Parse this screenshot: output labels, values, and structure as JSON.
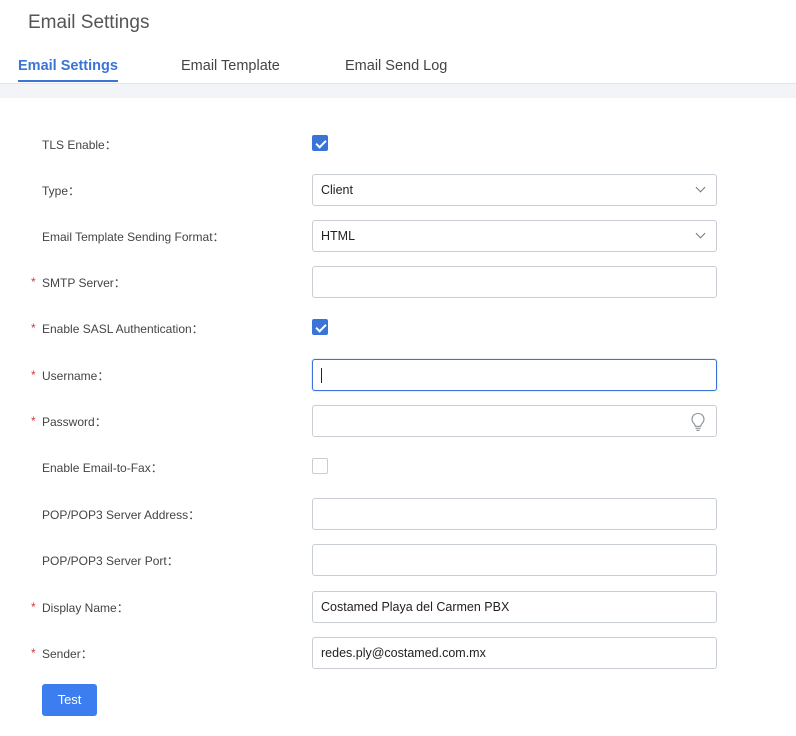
{
  "page": {
    "title": "Email Settings"
  },
  "tabs": [
    {
      "label": "Email Settings",
      "active": true
    },
    {
      "label": "Email Template",
      "active": false
    },
    {
      "label": "Email Send Log",
      "active": false
    }
  ],
  "form": {
    "tls_enable": {
      "label": "TLS Enable：",
      "checked": true,
      "required": false
    },
    "type": {
      "label": "Type：",
      "value": "Client",
      "required": false
    },
    "sending_format": {
      "label": "Email Template Sending Format：",
      "value": "HTML",
      "required": false
    },
    "smtp_server": {
      "label": "SMTP Server：",
      "value": "",
      "required": true,
      "required_mark": "*"
    },
    "sasl_auth": {
      "label": "Enable SASL Authentication：",
      "checked": true,
      "required": true,
      "required_mark": "*"
    },
    "username": {
      "label": "Username：",
      "value": "",
      "required": true,
      "required_mark": "*",
      "focused": true
    },
    "password": {
      "label": "Password：",
      "value": "",
      "required": true,
      "required_mark": "*",
      "icon": "lightbulb-icon"
    },
    "email_to_fax": {
      "label": "Enable Email-to-Fax：",
      "checked": false,
      "required": false
    },
    "pop_server_address": {
      "label": "POP/POP3 Server Address：",
      "value": "",
      "required": false
    },
    "pop_server_port": {
      "label": "POP/POP3 Server Port：",
      "value": "",
      "required": false
    },
    "display_name": {
      "label": "Display Name：",
      "value": "Costamed Playa del Carmen PBX",
      "required": true,
      "required_mark": "*"
    },
    "sender": {
      "label": "Sender：",
      "value": "redes.ply@costamed.com.mx",
      "required": true,
      "required_mark": "*"
    }
  },
  "actions": {
    "test_label": "Test"
  },
  "colors": {
    "accent": "#3a74d6",
    "button": "#3c7ef0",
    "required": "#d9363e"
  }
}
